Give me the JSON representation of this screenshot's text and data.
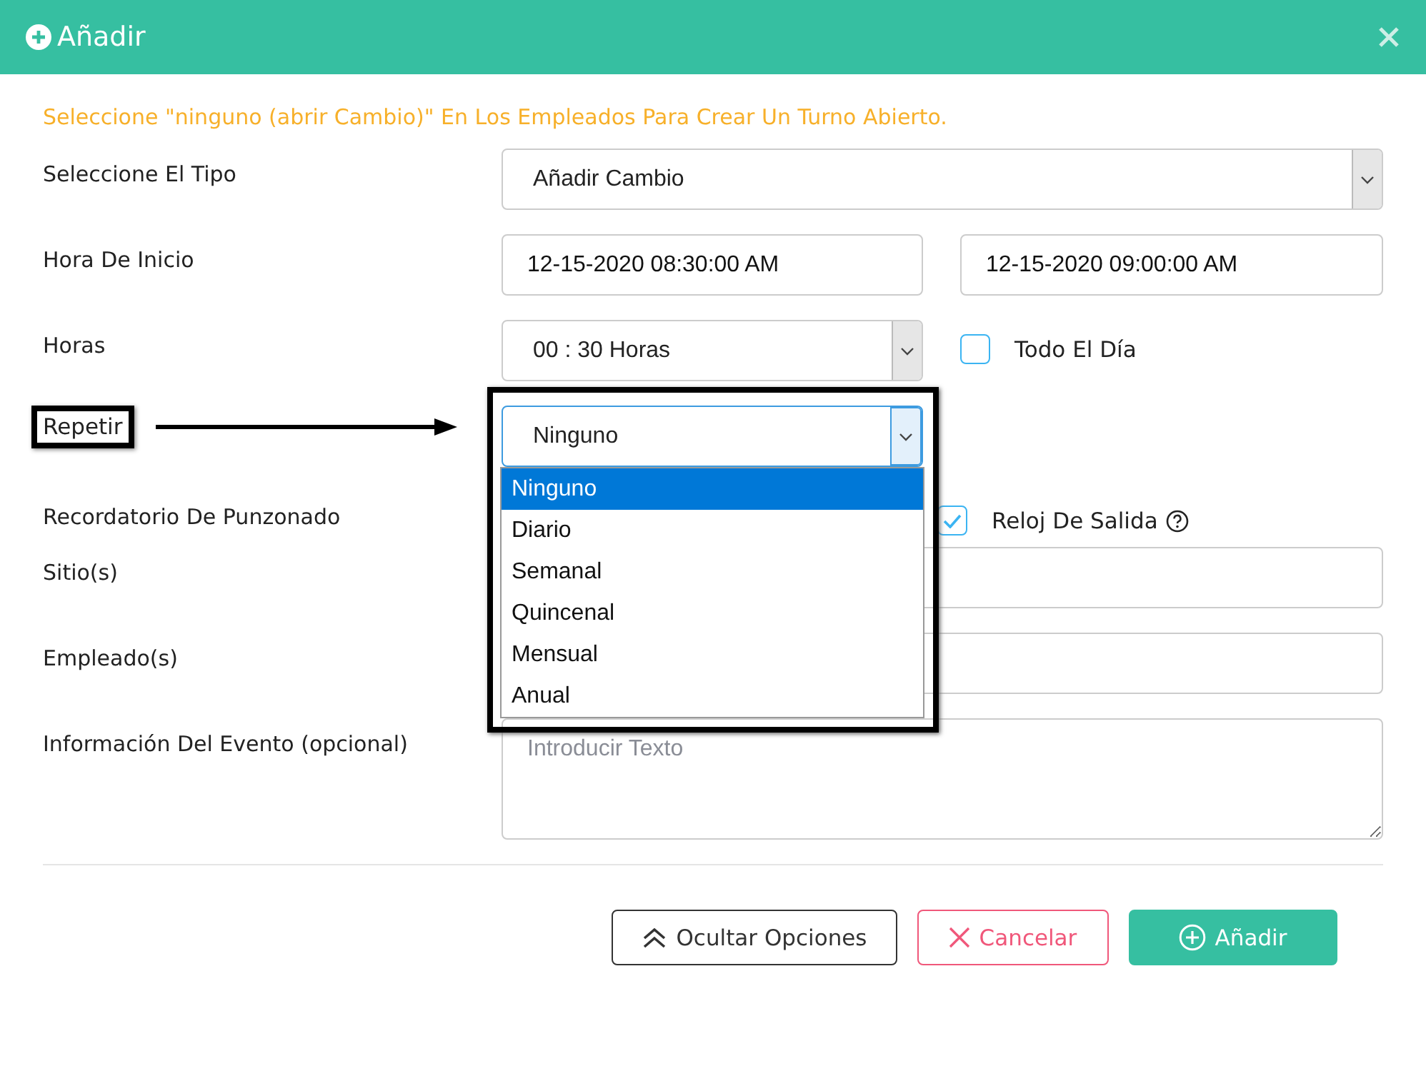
{
  "header": {
    "title": "Añadir"
  },
  "notice": "Seleccione \"ninguno (abrir Cambio)\" En Los Empleados Para Crear Un Turno Abierto.",
  "fields": [
    {
      "kind": "select",
      "label": "Seleccione El Tipo",
      "value": "Añadir Cambio"
    },
    {
      "kind": "datetime",
      "label": "Hora De Inicio",
      "values": [
        "12-15-2020 08:30:00 AM",
        "12-15-2020 09:00:00 AM"
      ]
    },
    {
      "kind": "select",
      "label": "Horas",
      "value": "00 : 30 Horas",
      "half": true,
      "checkbox": {
        "label": "Todo El Día",
        "checked": false
      }
    },
    {
      "kind": "select",
      "label": "Repetir",
      "value": "Ninguno",
      "half": true,
      "annotated": true,
      "open": true,
      "options": [
        {
          "label": "Ninguno",
          "selected": true
        },
        {
          "label": "Diario",
          "selected": false
        },
        {
          "label": "Semanal",
          "selected": false
        },
        {
          "label": "Quincenal",
          "selected": false
        },
        {
          "label": "Mensual",
          "selected": false
        },
        {
          "label": "Anual",
          "selected": false
        }
      ]
    },
    {
      "kind": "checkbox",
      "label": "Recordatorio De Punzonado",
      "checkbox": {
        "label": "Reloj De Salida",
        "checked": true,
        "help": true
      }
    },
    {
      "kind": "input",
      "label": "Sitio(s)"
    },
    {
      "kind": "input",
      "label": "Empleado(s)"
    },
    {
      "kind": "textarea",
      "label": "Información Del Evento (opcional)",
      "placeholder": "Introducir Texto"
    }
  ],
  "buttons": [
    {
      "kind": "outline",
      "label": "Ocultar Opciones"
    },
    {
      "kind": "danger",
      "label": "Cancelar"
    },
    {
      "kind": "primary",
      "label": "Añadir"
    }
  ]
}
